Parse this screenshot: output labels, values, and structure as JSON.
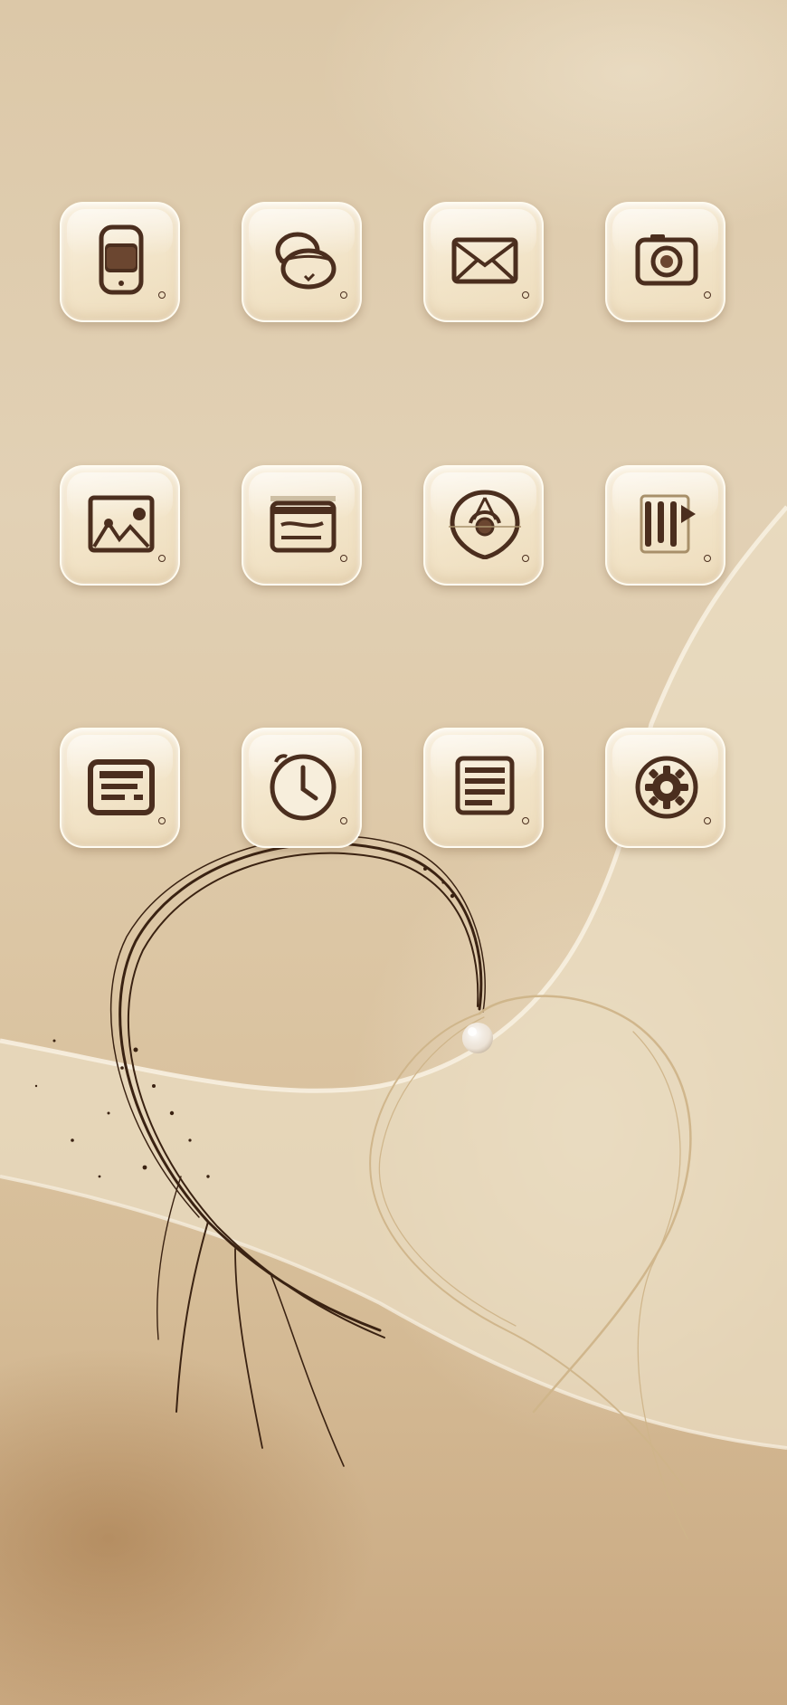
{
  "colors": {
    "icon_stroke": "#4b2e1e",
    "icon_fill": "#f3e6cc",
    "paper": "#dcc8a8",
    "ink": "#3a2212",
    "thread": "#cfb58a"
  },
  "home_screen": {
    "apps": [
      {
        "name": "phone",
        "icon": "phone-icon"
      },
      {
        "name": "messages",
        "icon": "chat-bubbles-icon"
      },
      {
        "name": "mail",
        "icon": "mail-icon"
      },
      {
        "name": "camera",
        "icon": "camera-icon"
      },
      {
        "name": "photos",
        "icon": "gallery-icon"
      },
      {
        "name": "wallet",
        "icon": "wallet-icon"
      },
      {
        "name": "compass",
        "icon": "compass-icon"
      },
      {
        "name": "music",
        "icon": "music-icon"
      },
      {
        "name": "calendar",
        "icon": "calendar-icon"
      },
      {
        "name": "clock",
        "icon": "clock-icon"
      },
      {
        "name": "notes",
        "icon": "notes-icon"
      },
      {
        "name": "settings",
        "icon": "gear-icon"
      }
    ]
  },
  "wallpaper": {
    "theme": "aged-paper-heart",
    "accent": "pearl"
  }
}
